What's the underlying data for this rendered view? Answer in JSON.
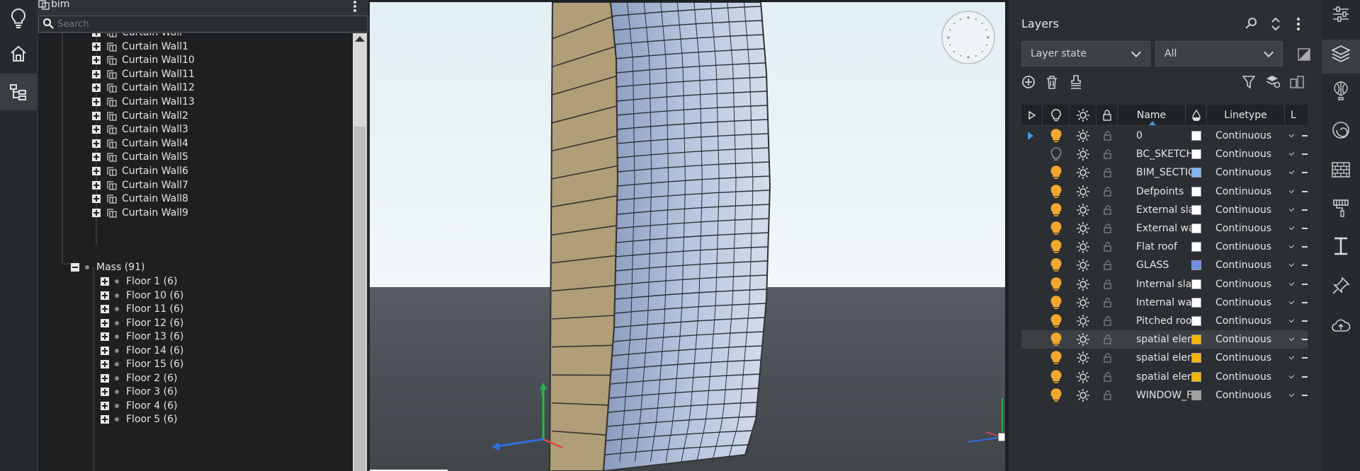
{
  "tree": {
    "title": "bim",
    "search_placeholder": "Search",
    "curtain_walls": [
      "Curtain Wall",
      "Curtain Wall1",
      "Curtain Wall10",
      "Curtain Wall11",
      "Curtain Wall12",
      "Curtain Wall13",
      "Curtain Wall2",
      "Curtain Wall3",
      "Curtain Wall4",
      "Curtain Wall5",
      "Curtain Wall6",
      "Curtain Wall7",
      "Curtain Wall8",
      "Curtain Wall9"
    ],
    "mass_label": "Mass (91)",
    "floors": [
      "Floor 1 (6)",
      "Floor 10 (6)",
      "Floor 11 (6)",
      "Floor 12 (6)",
      "Floor 13 (6)",
      "Floor 14 (6)",
      "Floor 15 (6)",
      "Floor 2 (6)",
      "Floor 3 (6)",
      "Floor 4 (6)",
      "Floor 5 (6)"
    ]
  },
  "layers": {
    "title": "Layers",
    "layer_state": "Layer state",
    "filter": "All",
    "columns": {
      "name": "Name",
      "linetype": "Linetype",
      "lw": "L"
    },
    "rows": [
      {
        "name": "0",
        "color": "#ffffff",
        "linetype": "Continuous",
        "on": true
      },
      {
        "name": "BC_SKETCHES",
        "color": "#ffffff",
        "linetype": "Continuous",
        "on": false
      },
      {
        "name": "BIM_SECTION",
        "color": "#7fb5f0",
        "linetype": "Continuous",
        "on": true
      },
      {
        "name": "Defpoints",
        "color": "#ffffff",
        "linetype": "Continuous",
        "on": true
      },
      {
        "name": "External slab",
        "color": "#ffffff",
        "linetype": "Continuous",
        "on": true
      },
      {
        "name": "External wall",
        "color": "#ffffff",
        "linetype": "Continuous",
        "on": true
      },
      {
        "name": "Flat roof",
        "color": "#ffffff",
        "linetype": "Continuous",
        "on": true
      },
      {
        "name": "GLASS",
        "color": "#6f8fe8",
        "linetype": "Continuous",
        "on": true
      },
      {
        "name": "Internal slab",
        "color": "#ffffff",
        "linetype": "Continuous",
        "on": true
      },
      {
        "name": "Internal wall",
        "color": "#ffffff",
        "linetype": "Continuous",
        "on": true
      },
      {
        "name": "Pitched roof",
        "color": "#ffffff",
        "linetype": "Continuous",
        "on": true
      },
      {
        "name": "spatial elemer",
        "color": "#f5b400",
        "linetype": "Continuous",
        "on": true
      },
      {
        "name": "spatial elemer",
        "color": "#f5b400",
        "linetype": "Continuous",
        "on": true
      },
      {
        "name": "spatial elemer",
        "color": "#f5b400",
        "linetype": "Continuous",
        "on": true
      },
      {
        "name": "WINDOW_FRA",
        "color": "#a0a0a0",
        "linetype": "Continuous",
        "on": true
      }
    ]
  },
  "colors": {
    "accent": "#f0a830",
    "selection": "#4a90d9"
  },
  "icons": [
    "bulb-icon",
    "home-icon",
    "tree-icon",
    "search-icon",
    "more-icon",
    "sliders-icon",
    "layers-icon",
    "balloon-icon",
    "spiral-icon",
    "brick-icon",
    "paint-icon",
    "beam-icon",
    "pin-icon",
    "cloud-icon"
  ]
}
